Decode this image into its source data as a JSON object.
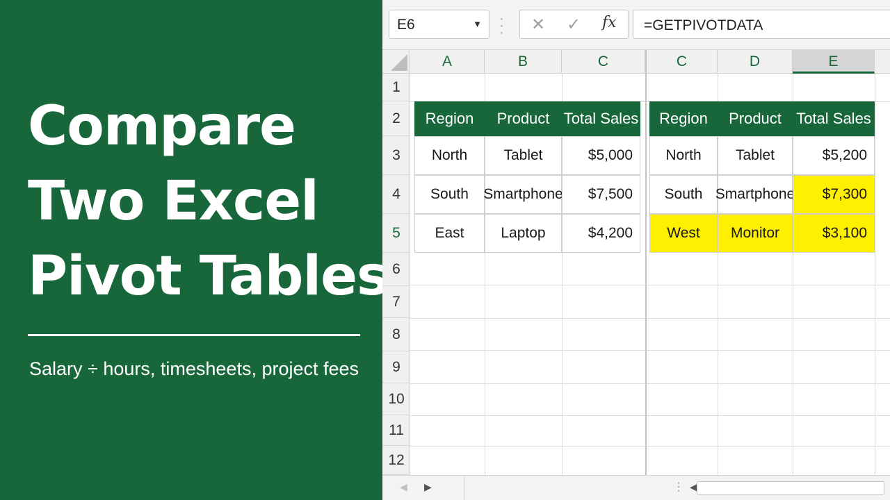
{
  "banner": {
    "title_lines": [
      "Compare",
      "Two Excel",
      "Pivot Tables"
    ],
    "subtitle": "Salary ÷ hours, timesheets, project fees"
  },
  "formula_bar": {
    "name_box": "E6",
    "formula": "=GETPIVOTDATA",
    "cancel_icon": "✕",
    "enter_icon": "✓",
    "fx_label": "fx"
  },
  "grid": {
    "columns": [
      "A",
      "B",
      "C",
      "C",
      "D",
      "E"
    ],
    "selected_column": "E",
    "rows": [
      "1",
      "2",
      "3",
      "4",
      "5",
      "6",
      "7",
      "8",
      "9",
      "10",
      "11",
      "12"
    ],
    "selected_row": "5"
  },
  "table_left": {
    "headers": [
      "Region",
      "Product",
      "Total Sales"
    ],
    "rows": [
      [
        "North",
        "Tablet",
        "$5,000"
      ],
      [
        "South",
        "Smartphone",
        "$7,500"
      ],
      [
        "East",
        "Laptop",
        "$4,200"
      ]
    ]
  },
  "table_right": {
    "headers": [
      "Region",
      "Product",
      "Total Sales"
    ],
    "rows": [
      [
        "North",
        "Tablet",
        "$5,200"
      ],
      [
        "South",
        "Smartphone",
        "$7,300"
      ],
      [
        "West",
        "Monitor",
        "$3,100"
      ]
    ]
  },
  "colors": {
    "accent": "#17673a",
    "highlight": "#ffef00"
  }
}
